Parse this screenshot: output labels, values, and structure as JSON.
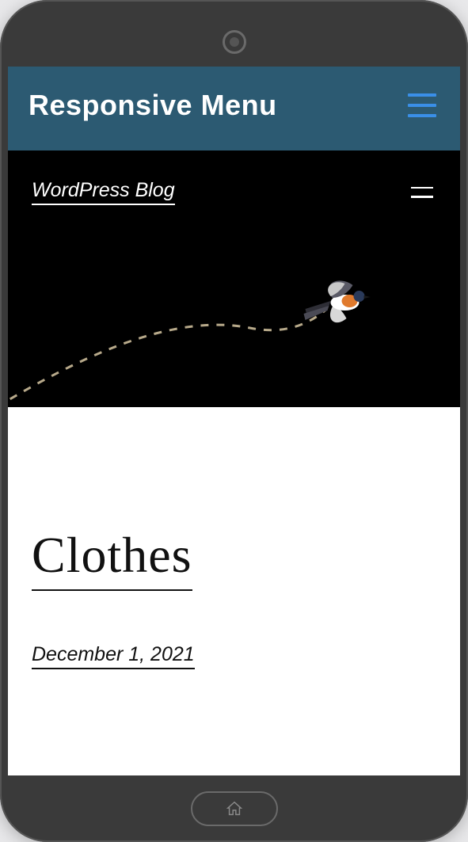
{
  "rm_header": {
    "title": "Responsive Menu"
  },
  "wp_header": {
    "site_title": "WordPress Blog"
  },
  "post": {
    "title": "Clothes",
    "date": "December 1, 2021"
  },
  "colors": {
    "rm_header_bg": "#2c5a72",
    "hamburger_blue": "#3a8fe8",
    "hero_bg": "#000000"
  }
}
